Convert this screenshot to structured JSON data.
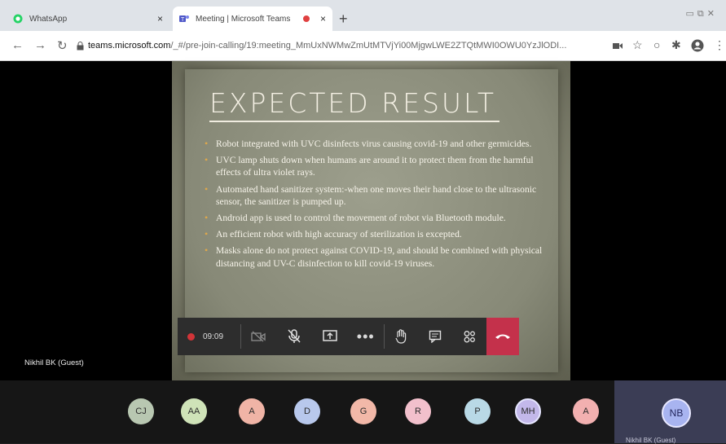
{
  "browser": {
    "tabs": [
      {
        "label": "WhatsApp",
        "close": "×",
        "icon": "whatsapp-icon"
      },
      {
        "label": "Meeting | Microsoft Teams",
        "close": "×",
        "icon": "teams-icon"
      }
    ],
    "new_tab": "+",
    "url_host": "teams.microsoft.com",
    "url_path": "/_#/pre-join-calling/19:meeting_MmUxNWMwZmUtMTVjYi00MjgwLWE2ZTQtMWI0OWU0YzJlODI..."
  },
  "slide": {
    "title": "EXPECTED RESULT",
    "bullets": [
      "Robot integrated with UVC disinfects virus causing covid-19 and other germicides.",
      "UVC lamp shuts down when humans are around it to protect them from the harmful effects of ultra violet rays.",
      "Automated hand sanitizer system:-when one moves their hand close to the ultrasonic sensor, the sanitizer is pumped up.",
      "Android app is used to control the movement of robot via Bluetooth module.",
      "An efficient robot with high accuracy of sterilization is excepted.",
      "Masks alone do not protect against COVID-19, and should be combined with physical distancing and UV-C disinfection to kill covid-19 viruses."
    ]
  },
  "call": {
    "timer": "09:09",
    "presenter_name": "Nikhil BK (Guest)"
  },
  "participants": [
    {
      "initials": "CJ",
      "color": "#b8c7b1"
    },
    {
      "initials": "AA",
      "color": "#cfe3b8"
    },
    {
      "initials": "A",
      "color": "#f0b4a6"
    },
    {
      "initials": "D",
      "color": "#b8c8ec"
    },
    {
      "initials": "G",
      "color": "#f2b8a8"
    },
    {
      "initials": "R",
      "color": "#f2c0cc"
    },
    {
      "initials": "P",
      "color": "#b9d9e6"
    },
    {
      "initials": "MH",
      "color": "#c3b8ea"
    },
    {
      "initials": "A",
      "color": "#f2b0b0"
    }
  ],
  "self": {
    "initials": "NB",
    "name": "Nikhil BK (Guest)"
  },
  "colors": {
    "hangup": "#c4314b",
    "record": "#d13438",
    "teams_accent": "#6264a7"
  }
}
